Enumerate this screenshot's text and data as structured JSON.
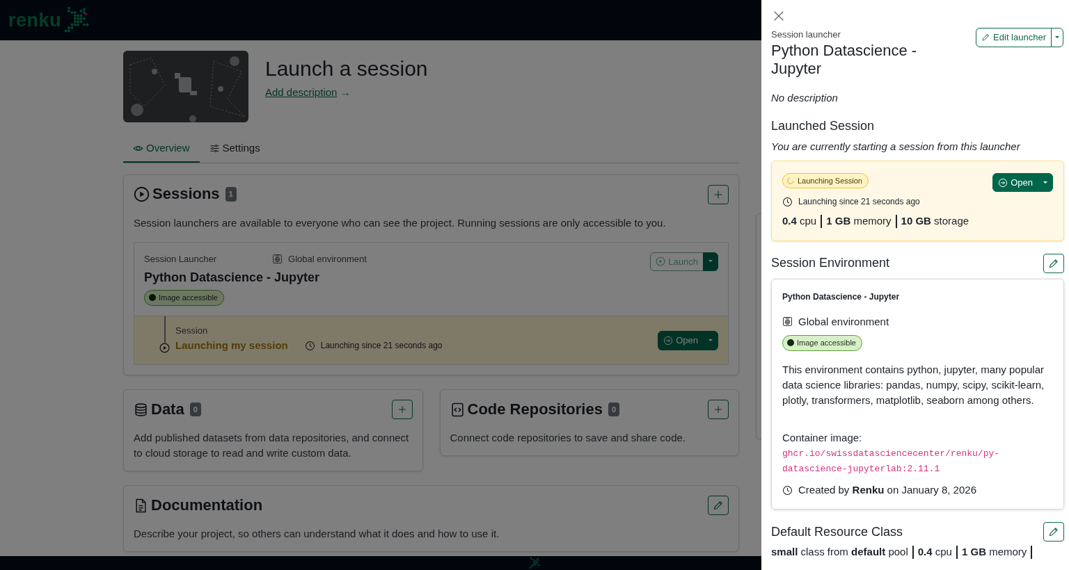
{
  "navbar": {
    "logo": "renku"
  },
  "project": {
    "title": "Launch a session",
    "add_description": "Add description",
    "arrow": "→",
    "tabs": [
      {
        "label": "Overview",
        "selected": true
      },
      {
        "label": "Settings",
        "selected": false
      }
    ]
  },
  "sessions": {
    "title": "Sessions",
    "count": "1",
    "description": "Session launchers are available to everyone who can see the project. Running sessions are only accessible to you.",
    "launcher": {
      "label": "Session Launcher",
      "environment": "Global environment",
      "name": "Python Datascience - Jupyter",
      "image_status": "Image accessible",
      "launch_button": "Launch",
      "session": {
        "label": "Session",
        "name": "Launching my session",
        "status": "Launching since 21 seconds ago",
        "open_button": "Open"
      }
    }
  },
  "sections": [
    {
      "kind": "data",
      "title": "Data",
      "count": "0",
      "description": "Add published datasets from data repositories, and connect to cloud storage to read and write custom data."
    },
    {
      "kind": "code",
      "title": "Code Repositories",
      "count": "0",
      "description": "Connect code repositories to save and share code."
    },
    {
      "kind": "docs",
      "title": "Documentation",
      "description": "Describe your project, so others can understand what it does and how to use it."
    }
  ],
  "panel": {
    "label": "Session launcher",
    "title": "Python Datascience - Jupyter",
    "edit_button": "Edit launcher",
    "description": "No description",
    "launched": {
      "title": "Launched Session",
      "subtitle": "You are currently starting a session from this launcher",
      "status": "Launching Session",
      "open_button": "Open",
      "since": "Launching since 21 seconds ago",
      "resources": [
        "**0.4** cpu",
        "**1 GB** memory",
        "**10 GB** storage"
      ]
    },
    "environment": {
      "title": "Session Environment",
      "name": "Python Datascience - Jupyter",
      "type": "Global environment",
      "image_status": "Image accessible",
      "description": "This environment contains python, jupyter, many popular data science libraries: pandas, numpy, scipy, scikit-learn, plotly, transformers, matplotlib, seaborn among others.",
      "container_label": "Container image:",
      "container_image": "ghcr.io/swissdatasciencecenter/renku/py-datascience-jupyterlab:2.11.1",
      "created": "Created by **Renku** on January 8, 2026"
    },
    "resource_class": {
      "title": "Default Resource Class",
      "items": [
        "**small** class from **default** pool",
        "**0.4** cpu",
        "**1 GB** memory"
      ]
    }
  }
}
